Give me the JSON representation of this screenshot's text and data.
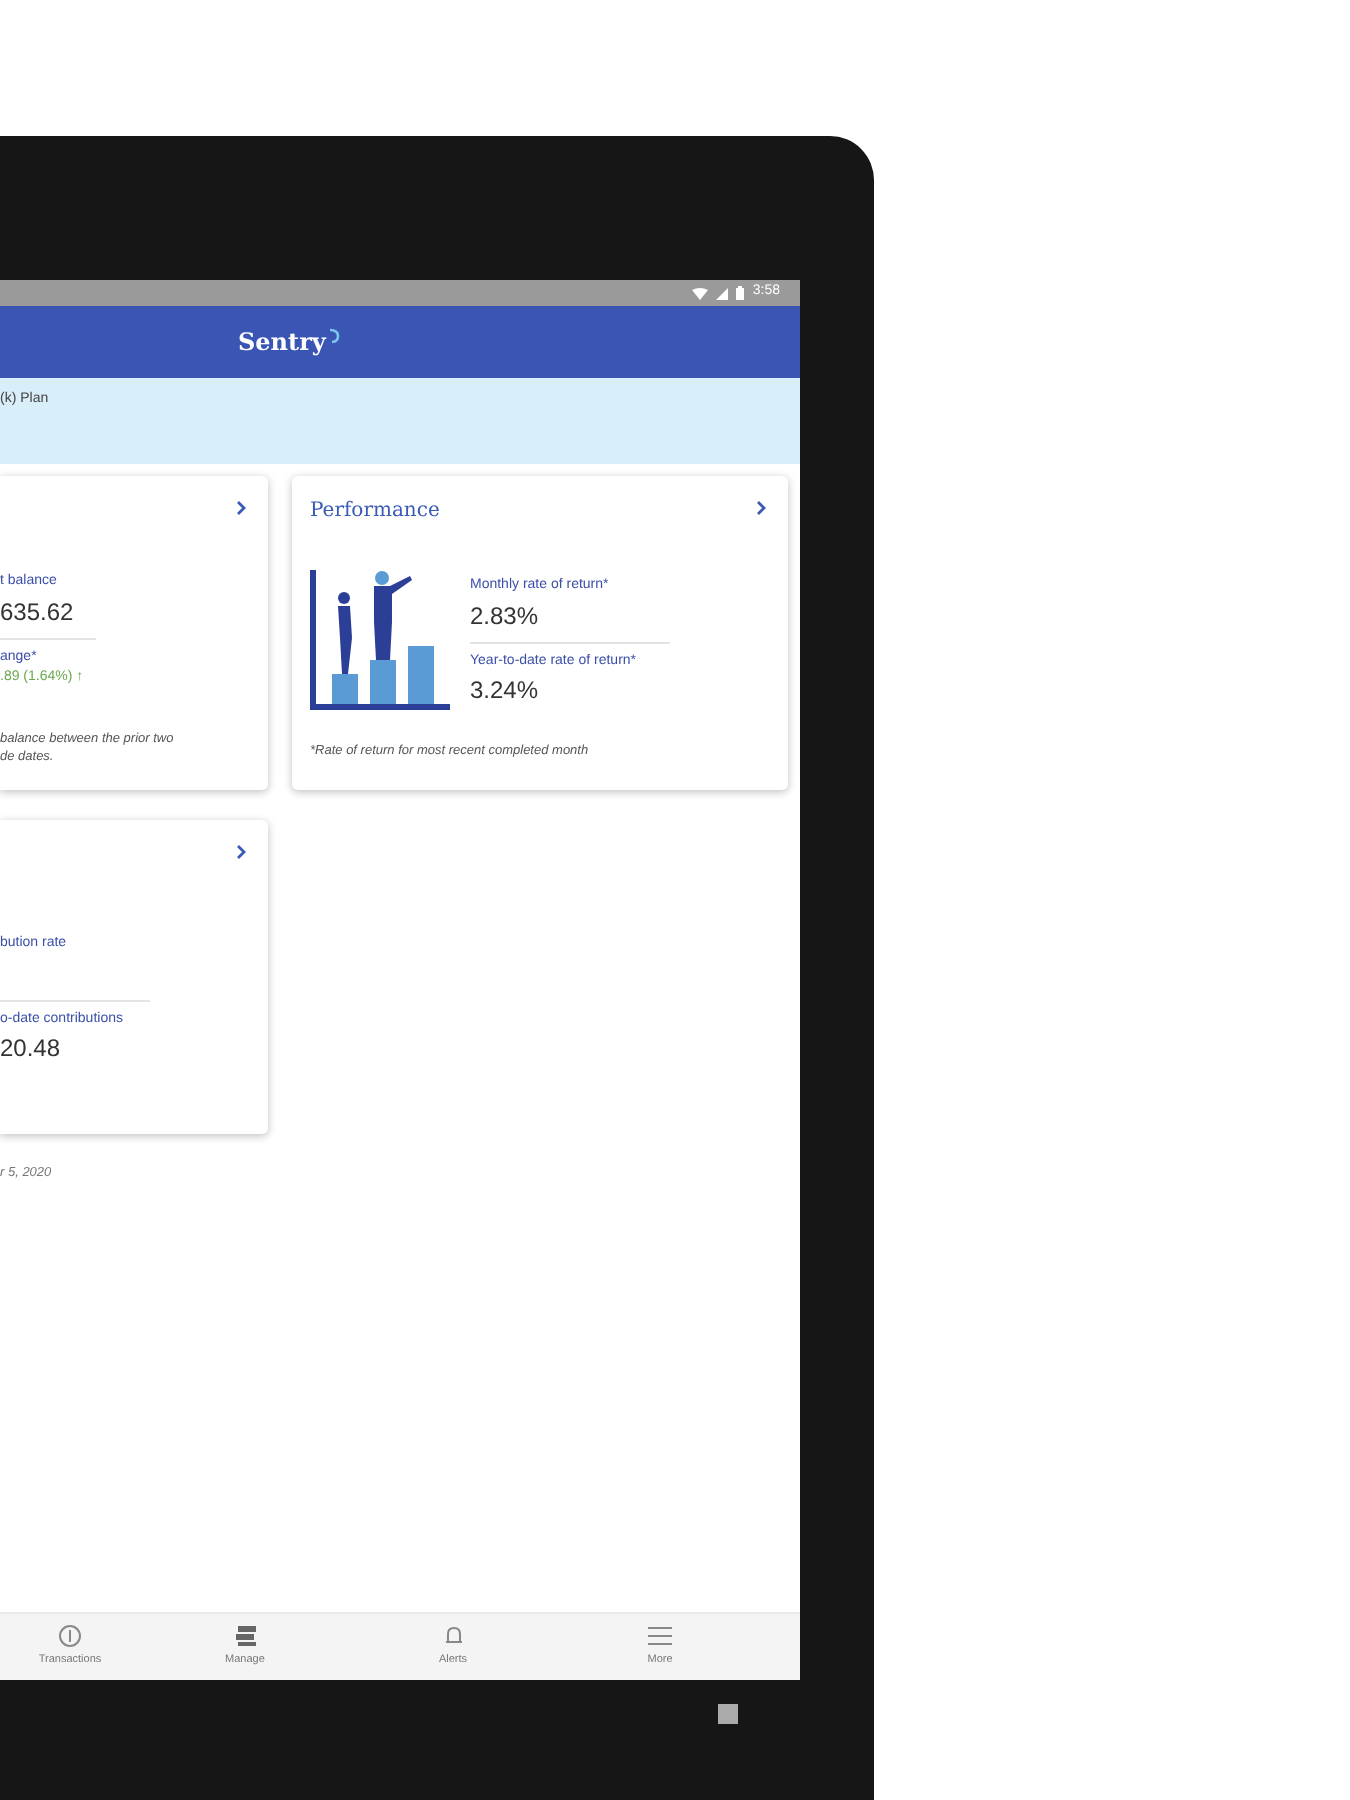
{
  "status_bar": {
    "time": "3:58"
  },
  "header": {
    "logo": "Sentry"
  },
  "plan_banner": {
    "text": "(k) Plan"
  },
  "balance_card": {
    "fields": [
      {
        "label": "t balance",
        "value": "635.62"
      },
      {
        "label": "ange*",
        "value": ".89 (1.64%) ↑",
        "kind": "gain"
      }
    ],
    "note": [
      "balance between the prior two",
      "de dates."
    ]
  },
  "performance_card": {
    "title": "Performance",
    "fields": [
      {
        "label": "Monthly rate of return*",
        "value": "2.83%"
      },
      {
        "label": "Year-to-date rate of return*",
        "value": "3.24%"
      }
    ],
    "footnote": "*Rate of return for most recent completed month"
  },
  "contributions_card": {
    "fields": [
      {
        "label": "bution rate"
      },
      {
        "label": "o-date contributions",
        "value": "20.48"
      }
    ]
  },
  "as_of": "r 5, 2020",
  "bottom_nav": [
    {
      "label": "Transactions",
      "kind": "dollar"
    },
    {
      "label": "Manage",
      "kind": "stack"
    },
    {
      "label": "Alerts",
      "kind": "bell"
    },
    {
      "label": "More",
      "kind": "menu"
    }
  ]
}
